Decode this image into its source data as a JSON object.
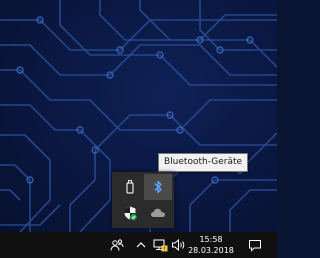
{
  "tooltip": {
    "text": "Bluetooth-Geräte"
  },
  "clock": {
    "time": "15:58",
    "date": "28.03.2018"
  },
  "flyout": {
    "icons": [
      "usb-device-icon",
      "bluetooth-icon",
      "windows-defender-icon",
      "onedrive-cloud-icon"
    ],
    "hovered": "bluetooth-icon"
  },
  "taskbar": {
    "icons": [
      "people-icon",
      "chevron-up-icon",
      "network-icon",
      "speaker-icon",
      "action-center-icon"
    ]
  },
  "colors": {
    "wallpaper": "#0a1740",
    "circuit": "#2a4f9a",
    "taskbar": "#101010",
    "flyout": "#2b2b2b",
    "bluetooth": "#5aa7ff"
  }
}
